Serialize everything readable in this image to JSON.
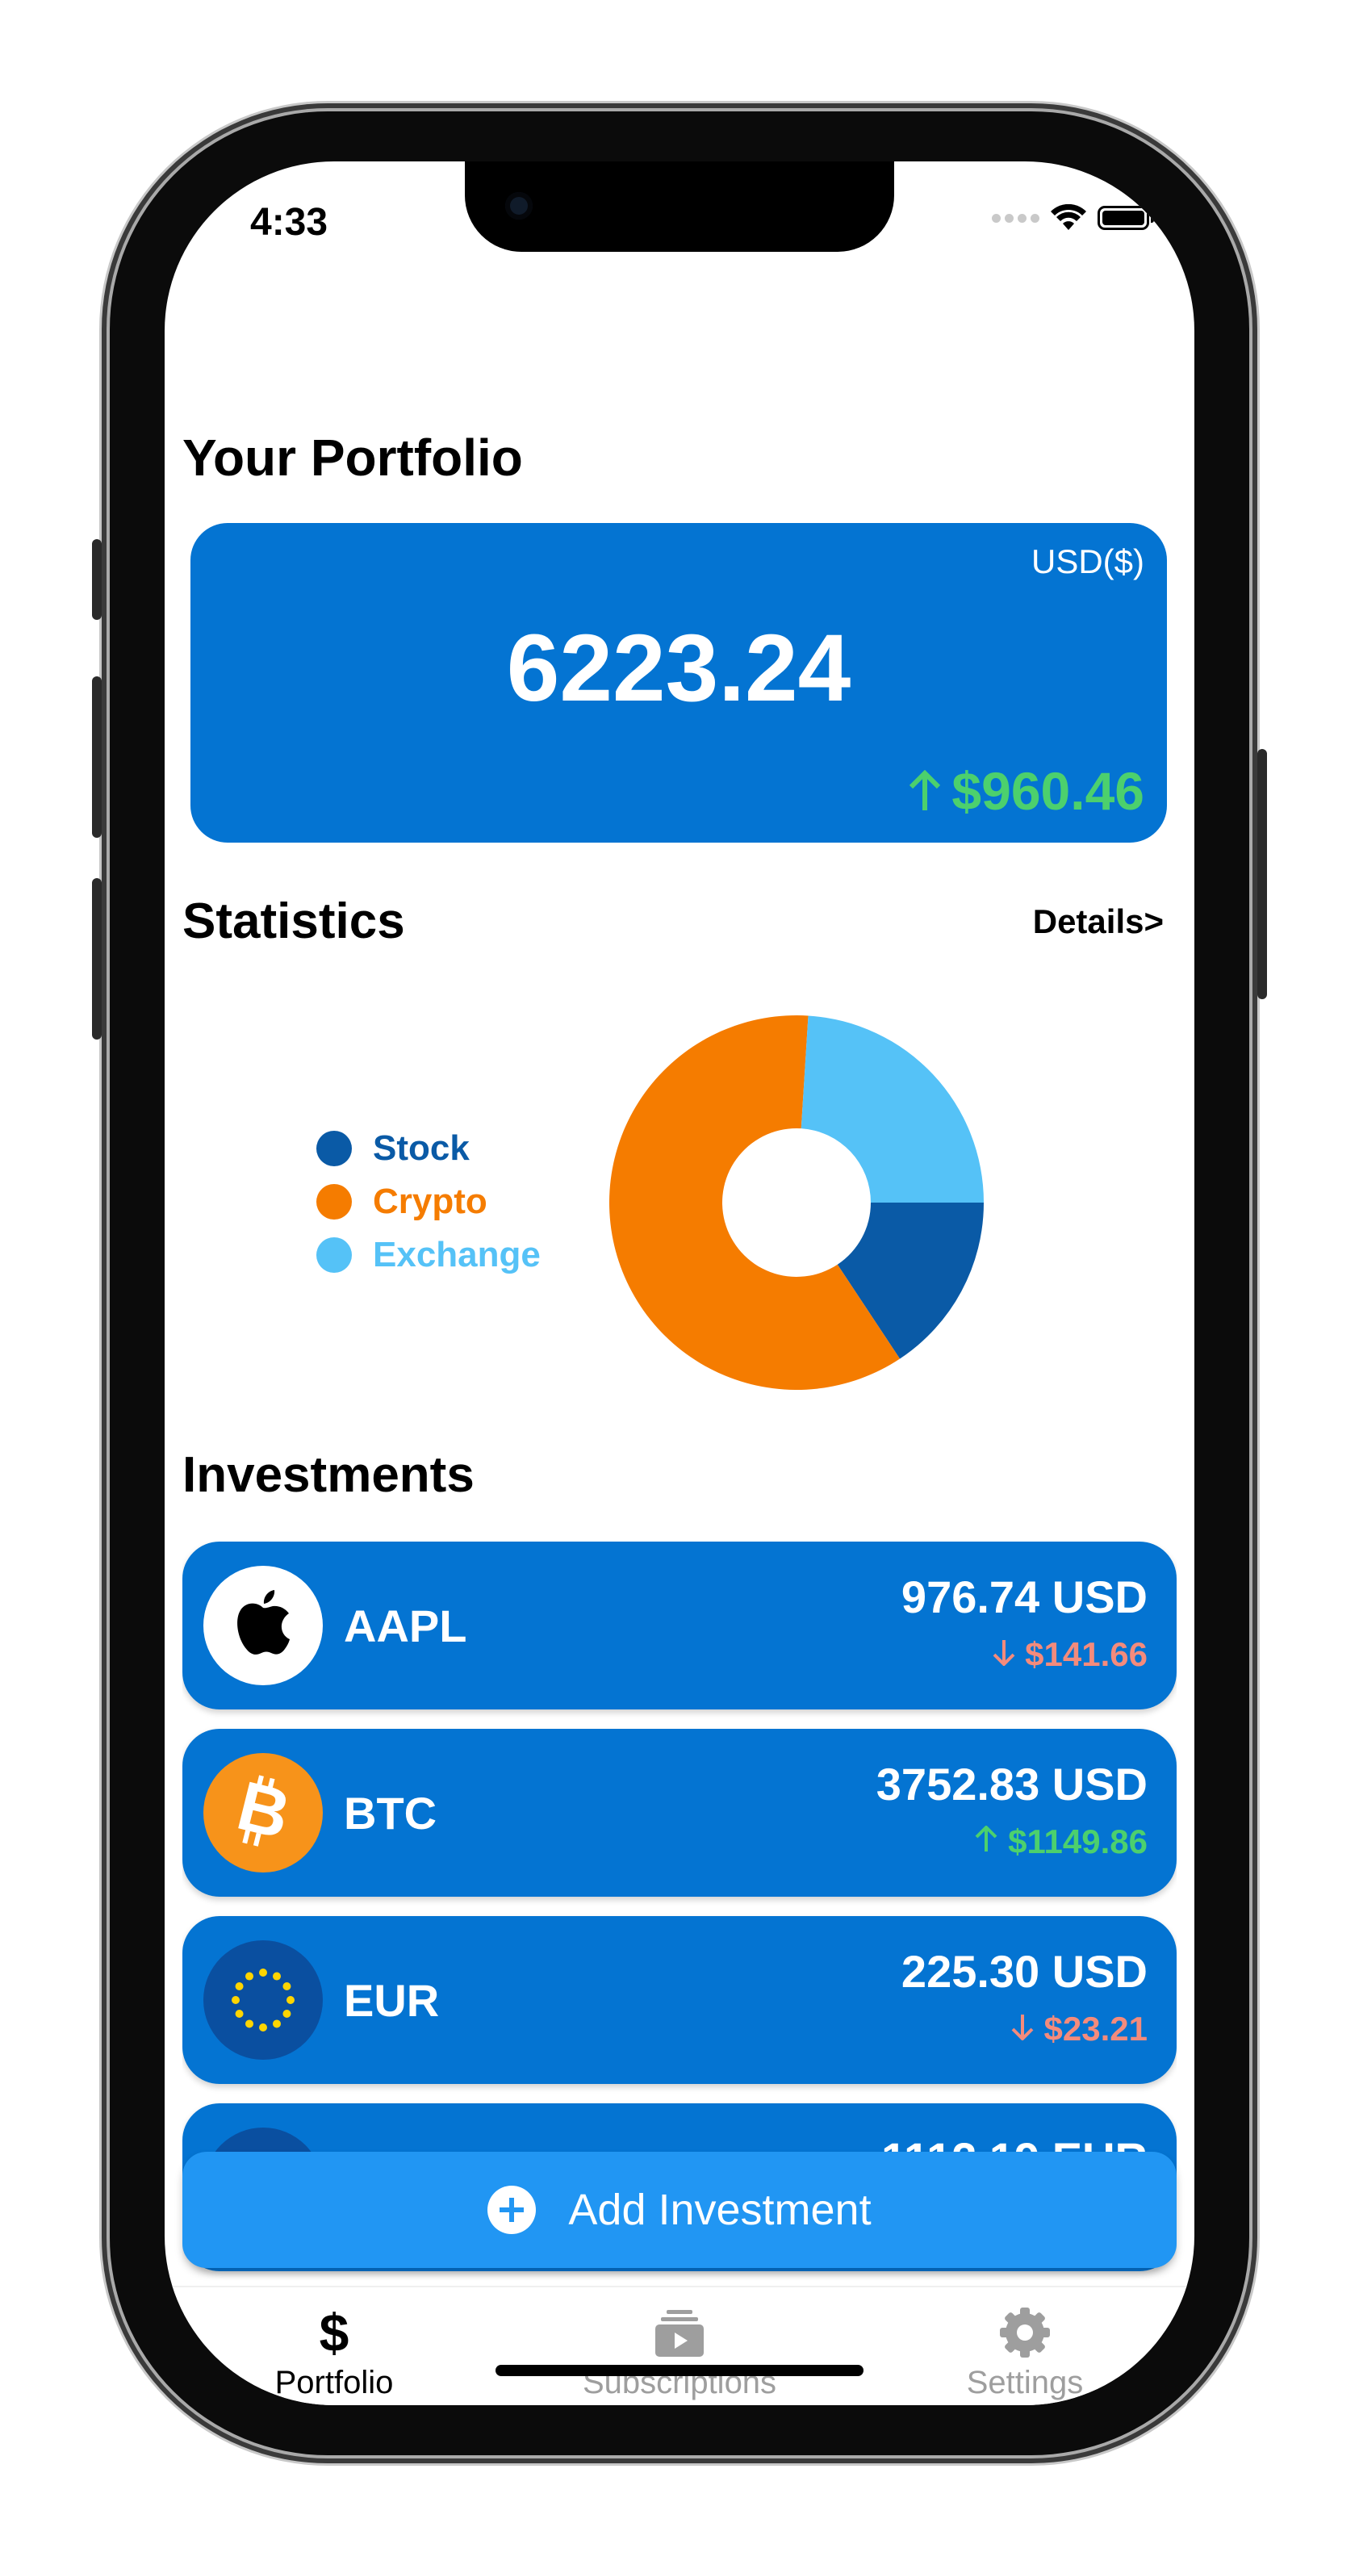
{
  "status_bar": {
    "time": "4:33"
  },
  "portfolio": {
    "title": "Your Portfolio",
    "currency": "USD($)",
    "total": "6223.24",
    "change": "$960.46",
    "change_direction": "up"
  },
  "statistics": {
    "title": "Statistics",
    "details_link": "Details>",
    "legend": [
      {
        "label": "Stock",
        "color": "#0a5aa6"
      },
      {
        "label": "Crypto",
        "color": "#f57c00"
      },
      {
        "label": "Exchange",
        "color": "#55c2f7"
      }
    ]
  },
  "chart_data": {
    "type": "pie",
    "donut": true,
    "categories": [
      "Stock",
      "Crypto",
      "Exchange"
    ],
    "values": [
      976.74,
      3752.83,
      1493.67
    ],
    "colors": [
      "#0a5aa6",
      "#f57c00",
      "#55c2f7"
    ]
  },
  "investments": {
    "title": "Investments",
    "items": [
      {
        "symbol": "AAPL",
        "value": "976.74 USD",
        "change": "$141.66",
        "direction": "down",
        "icon": "apple-icon"
      },
      {
        "symbol": "BTC",
        "value": "3752.83 USD",
        "change": "$1149.86",
        "direction": "up",
        "icon": "bitcoin-icon"
      },
      {
        "symbol": "EUR",
        "value": "225.30 USD",
        "change": "$23.21",
        "direction": "down",
        "icon": "eu-flag-icon"
      },
      {
        "symbol": "",
        "value": "1112.19 EUR",
        "change": "",
        "direction": "up",
        "icon": "flag-icon"
      }
    ]
  },
  "add_button": {
    "label": "Add Investment",
    "icon": "plus-circle-icon"
  },
  "tabbar": {
    "tabs": [
      {
        "label": "Portfolio",
        "icon": "dollar-icon",
        "active": true
      },
      {
        "label": "Subscriptions",
        "icon": "subscriptions-icon",
        "active": false
      },
      {
        "label": "Settings",
        "icon": "gear-icon",
        "active": false
      }
    ]
  },
  "colors": {
    "card_blue": "#0474d2",
    "button_blue": "#2196f3",
    "up_green": "#4cd06d",
    "down_red": "#f48b7c"
  }
}
